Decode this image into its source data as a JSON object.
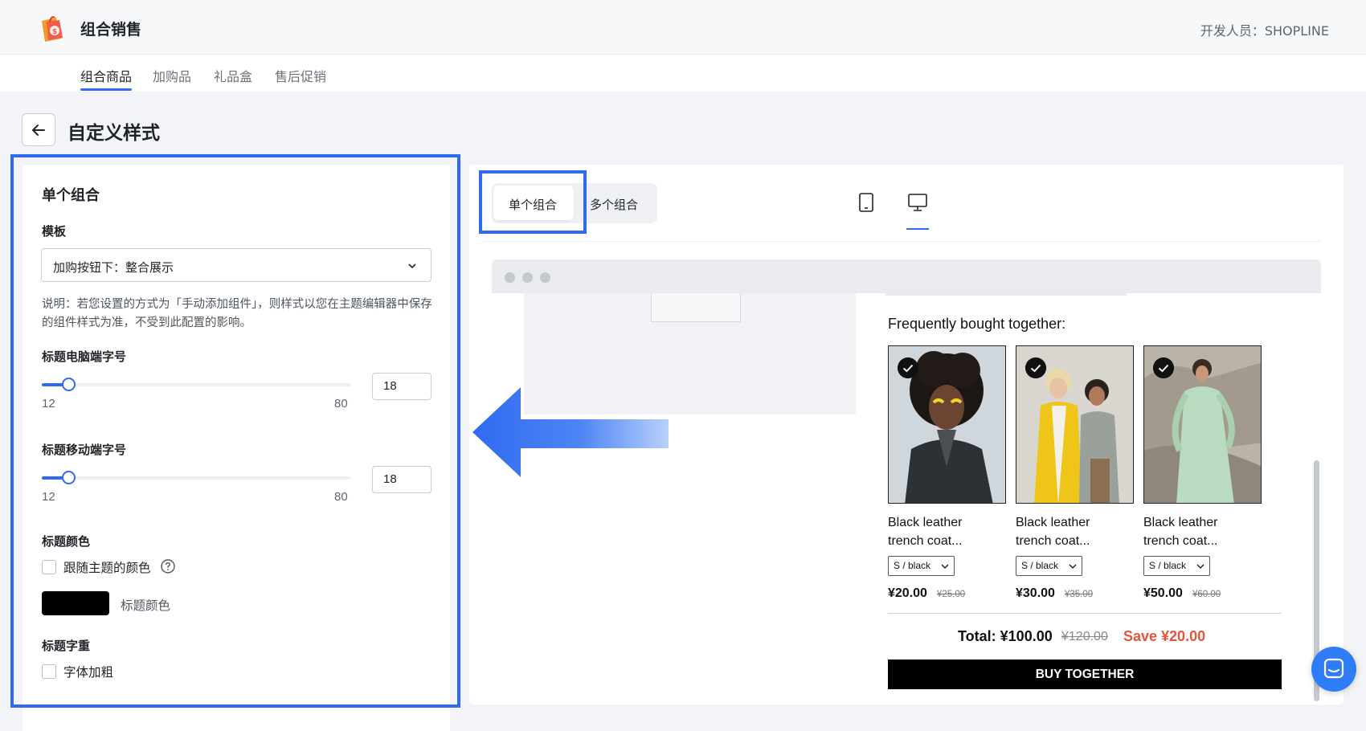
{
  "header": {
    "app_title": "组合销售",
    "developer": "开发人员：SHOPLINE"
  },
  "nav": {
    "tabs": [
      "组合商品",
      "加购品",
      "礼品盒",
      "售后促销"
    ],
    "active_index": 0
  },
  "page": {
    "title": "自定义样式"
  },
  "settings": {
    "panel_title": "单个组合",
    "template_label": "模板",
    "template_value": "加购按钮下：整合展示",
    "note": "说明：若您设置的方式为「手动添加组件」，则样式以您在主题编辑器中保存的组件样式为准，不受到此配置的影响。",
    "desktop_size_label": "标题电脑端字号",
    "desktop_size": {
      "min": "12",
      "max": "80",
      "value": "18"
    },
    "mobile_size_label": "标题移动端字号",
    "mobile_size": {
      "min": "12",
      "max": "80",
      "value": "18"
    },
    "color_label": "标题颜色",
    "follow_theme_label": "跟随主题的颜色",
    "follow_theme_checked": false,
    "color_value": "#000000",
    "color_swatch_label": "标题颜色",
    "weight_label": "标题字重",
    "bold_label": "字体加粗",
    "bold_checked": false
  },
  "preview": {
    "segments": [
      "单个组合",
      "多个组合"
    ],
    "active_segment": 0,
    "devices": [
      "mobile-icon",
      "desktop-icon"
    ],
    "active_device": 1,
    "fbt_title": "Frequently bought together:",
    "items": [
      {
        "name_line1": "Black leather",
        "name_line2": "trench coat...",
        "variant": "S / black",
        "price": "¥20.00",
        "old_price": "¥25.00"
      },
      {
        "name_line1": "Black leather",
        "name_line2": "trench coat...",
        "variant": "S / black",
        "price": "¥30.00",
        "old_price": "¥35.00"
      },
      {
        "name_line1": "Black leather",
        "name_line2": "trench coat...",
        "variant": "S / black",
        "price": "¥50.00",
        "old_price": "¥60.00"
      }
    ],
    "total": "Total: ¥100.00",
    "total_old": "¥120.00",
    "save": "Save ¥20.00",
    "buy_button": "BUY TOGETHER"
  },
  "colors": {
    "accent": "#2f6bf0",
    "save": "#e3543a",
    "chat": "#2f7df6"
  }
}
